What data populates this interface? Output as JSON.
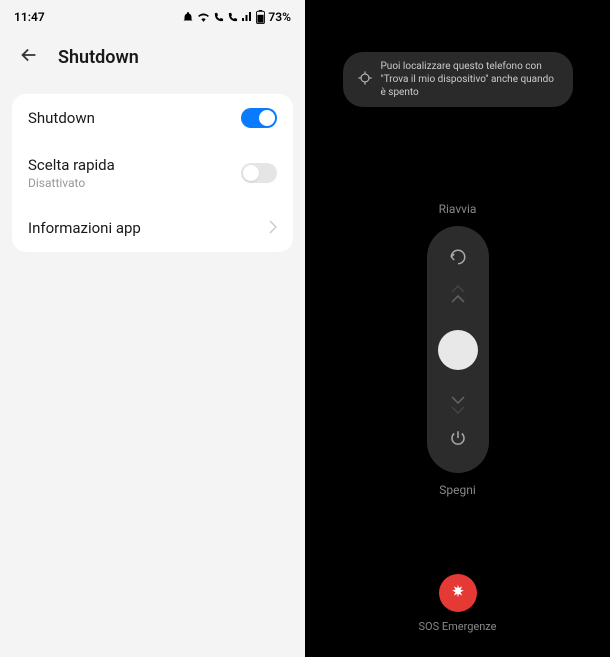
{
  "statusBar": {
    "time": "11:47",
    "battery": "73%"
  },
  "header": {
    "title": "Shutdown"
  },
  "settings": {
    "shutdown": {
      "label": "Shutdown",
      "enabled": true
    },
    "quickToggle": {
      "label": "Scelta rapida",
      "subtitle": "Disattivato",
      "enabled": false
    },
    "appInfo": {
      "label": "Informazioni app"
    }
  },
  "powerMenu": {
    "hint": "Puoi localizzare questo telefono con \"Trova il mio dispositivo\" anche quando è spento",
    "restartLabel": "Riavvia",
    "shutdownLabel": "Spegni",
    "sosLabel": "SOS Emergenze"
  }
}
